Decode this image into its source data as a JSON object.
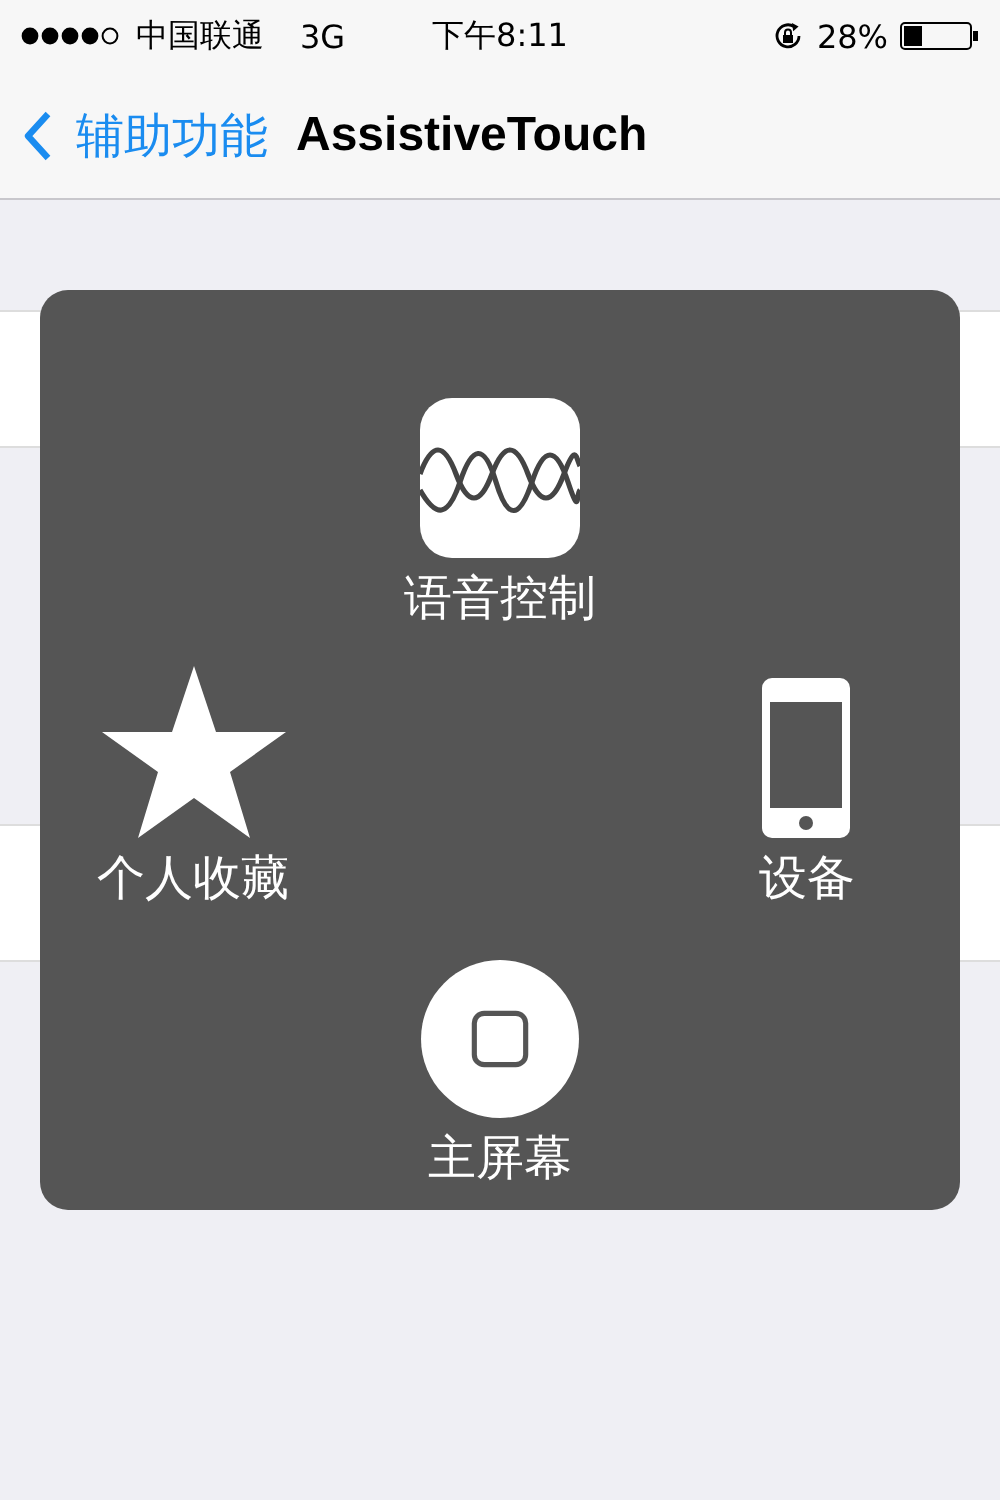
{
  "status_bar": {
    "carrier": "中国联通",
    "network": "3G",
    "time": "下午8:11",
    "battery": "28%"
  },
  "nav_bar": {
    "back_label": "辅助功能",
    "title": "AssistiveTouch"
  },
  "assistive_menu": [
    {
      "kind": "voice",
      "label": "语音控制"
    },
    {
      "kind": "favorites",
      "label": "个人收藏"
    },
    {
      "kind": "device",
      "label": "设备"
    },
    {
      "kind": "home",
      "label": "主屏幕"
    }
  ]
}
